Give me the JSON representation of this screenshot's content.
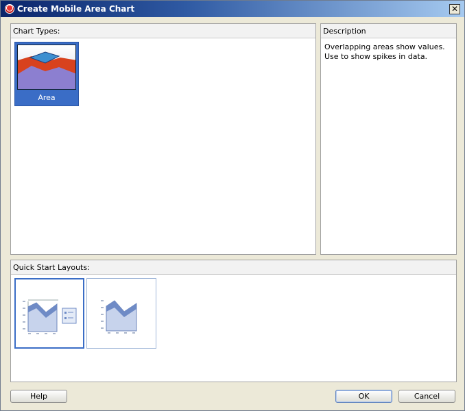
{
  "window": {
    "title": "Create Mobile Area Chart"
  },
  "chart_types": {
    "label": "Chart Types:",
    "items": [
      {
        "label": "Area",
        "selected": true
      }
    ]
  },
  "description": {
    "label": "Description",
    "text": "Overlapping areas show values. Use to show spikes in data."
  },
  "quick_start": {
    "label": "Quick Start Layouts:",
    "layouts": [
      {
        "name": "area-with-legend",
        "selected": true
      },
      {
        "name": "area-only",
        "selected": false
      }
    ]
  },
  "buttons": {
    "help": "Help",
    "ok": "OK",
    "cancel": "Cancel"
  },
  "colors": {
    "selection": "#3a6dc6",
    "title_bar": "#0a246a"
  }
}
